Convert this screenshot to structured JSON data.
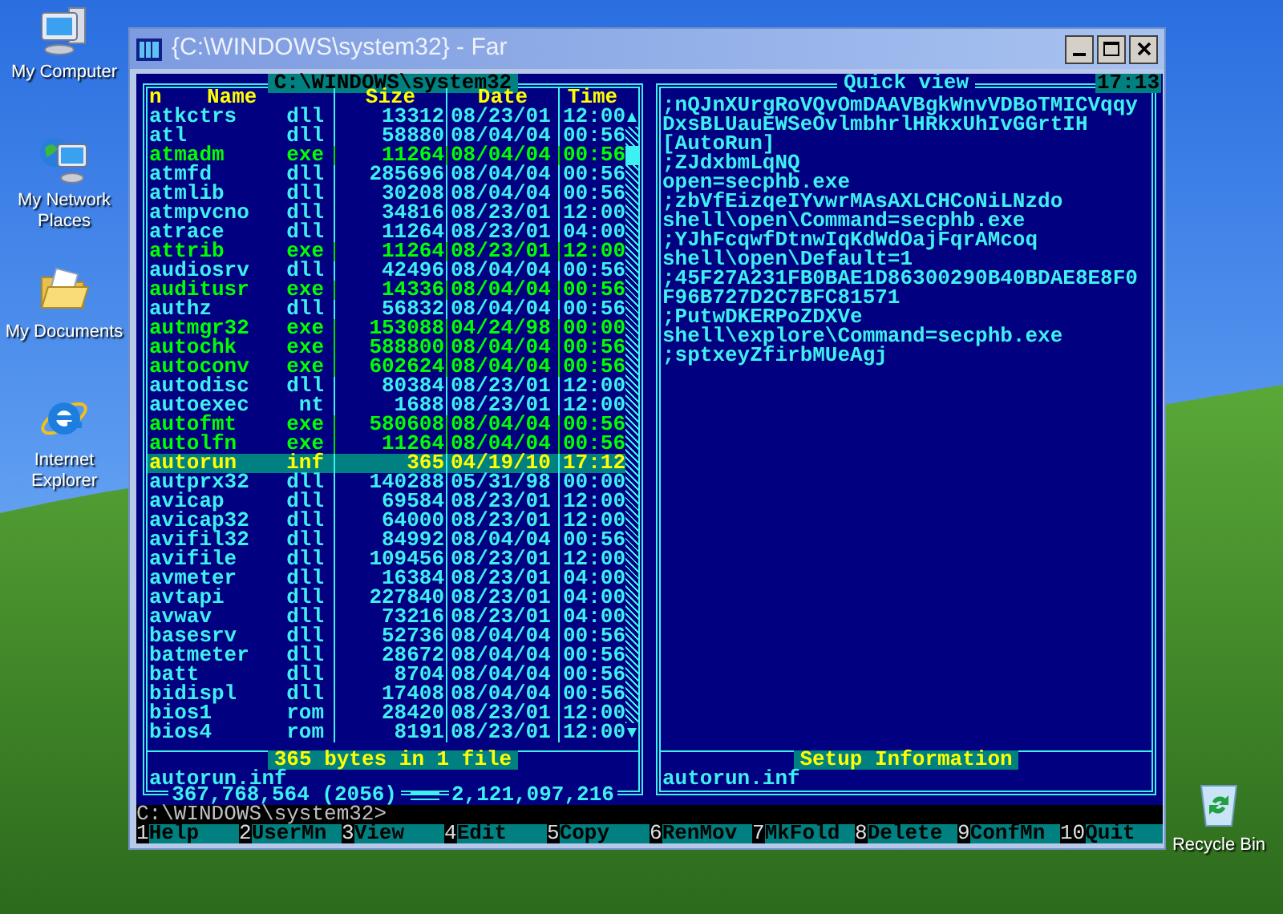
{
  "desktop_icons": [
    {
      "kind": "computer",
      "label": "My Computer"
    },
    {
      "kind": "network",
      "label": "My Network Places"
    },
    {
      "kind": "documents",
      "label": "My Documents"
    },
    {
      "kind": "browser",
      "label": "Internet Explorer"
    },
    {
      "kind": "recycle_bin",
      "label": "Recycle Bin"
    }
  ],
  "window": {
    "title": "{C:\\WINDOWS\\system32} - Far"
  },
  "left_panel": {
    "path": "C:\\WINDOWS\\system32",
    "columns": [
      "n",
      "Name",
      "Size",
      "Date",
      "Time"
    ],
    "files": [
      {
        "name": "atkctrs",
        "ext": "dll",
        "size": "13312",
        "date": "08/23/01",
        "time": "12:00",
        "executable": false,
        "selected": false
      },
      {
        "name": "atl",
        "ext": "dll",
        "size": "58880",
        "date": "08/04/04",
        "time": "00:56",
        "executable": false,
        "selected": false
      },
      {
        "name": "atmadm",
        "ext": "exe",
        "size": "11264",
        "date": "08/04/04",
        "time": "00:56",
        "executable": true,
        "selected": false
      },
      {
        "name": "atmfd",
        "ext": "dll",
        "size": "285696",
        "date": "08/04/04",
        "time": "00:56",
        "executable": false,
        "selected": false
      },
      {
        "name": "atmlib",
        "ext": "dll",
        "size": "30208",
        "date": "08/04/04",
        "time": "00:56",
        "executable": false,
        "selected": false
      },
      {
        "name": "atmpvcno",
        "ext": "dll",
        "size": "34816",
        "date": "08/23/01",
        "time": "12:00",
        "executable": false,
        "selected": false
      },
      {
        "name": "atrace",
        "ext": "dll",
        "size": "11264",
        "date": "08/23/01",
        "time": "04:00",
        "executable": false,
        "selected": false
      },
      {
        "name": "attrib",
        "ext": "exe",
        "size": "11264",
        "date": "08/23/01",
        "time": "12:00",
        "executable": true,
        "selected": false
      },
      {
        "name": "audiosrv",
        "ext": "dll",
        "size": "42496",
        "date": "08/04/04",
        "time": "00:56",
        "executable": false,
        "selected": false
      },
      {
        "name": "auditusr",
        "ext": "exe",
        "size": "14336",
        "date": "08/04/04",
        "time": "00:56",
        "executable": true,
        "selected": false
      },
      {
        "name": "authz",
        "ext": "dll",
        "size": "56832",
        "date": "08/04/04",
        "time": "00:56",
        "executable": false,
        "selected": false
      },
      {
        "name": "autmgr32",
        "ext": "exe",
        "size": "153088",
        "date": "04/24/98",
        "time": "00:00",
        "executable": true,
        "selected": false
      },
      {
        "name": "autochk",
        "ext": "exe",
        "size": "588800",
        "date": "08/04/04",
        "time": "00:56",
        "executable": true,
        "selected": false
      },
      {
        "name": "autoconv",
        "ext": "exe",
        "size": "602624",
        "date": "08/04/04",
        "time": "00:56",
        "executable": true,
        "selected": false
      },
      {
        "name": "autodisc",
        "ext": "dll",
        "size": "80384",
        "date": "08/23/01",
        "time": "12:00",
        "executable": false,
        "selected": false
      },
      {
        "name": "autoexec",
        "ext": "nt",
        "size": "1688",
        "date": "08/23/01",
        "time": "12:00",
        "executable": false,
        "selected": false
      },
      {
        "name": "autofmt",
        "ext": "exe",
        "size": "580608",
        "date": "08/04/04",
        "time": "00:56",
        "executable": true,
        "selected": false
      },
      {
        "name": "autolfn",
        "ext": "exe",
        "size": "11264",
        "date": "08/04/04",
        "time": "00:56",
        "executable": true,
        "selected": false
      },
      {
        "name": "autorun",
        "ext": "inf",
        "size": "365",
        "date": "04/19/10",
        "time": "17:12",
        "executable": false,
        "selected": true
      },
      {
        "name": "autprx32",
        "ext": "dll",
        "size": "140288",
        "date": "05/31/98",
        "time": "00:00",
        "executable": false,
        "selected": false
      },
      {
        "name": "avicap",
        "ext": "dll",
        "size": "69584",
        "date": "08/23/01",
        "time": "12:00",
        "executable": false,
        "selected": false
      },
      {
        "name": "avicap32",
        "ext": "dll",
        "size": "64000",
        "date": "08/23/01",
        "time": "12:00",
        "executable": false,
        "selected": false
      },
      {
        "name": "avifil32",
        "ext": "dll",
        "size": "84992",
        "date": "08/04/04",
        "time": "00:56",
        "executable": false,
        "selected": false
      },
      {
        "name": "avifile",
        "ext": "dll",
        "size": "109456",
        "date": "08/23/01",
        "time": "12:00",
        "executable": false,
        "selected": false
      },
      {
        "name": "avmeter",
        "ext": "dll",
        "size": "16384",
        "date": "08/23/01",
        "time": "04:00",
        "executable": false,
        "selected": false
      },
      {
        "name": "avtapi",
        "ext": "dll",
        "size": "227840",
        "date": "08/23/01",
        "time": "04:00",
        "executable": false,
        "selected": false
      },
      {
        "name": "avwav",
        "ext": "dll",
        "size": "73216",
        "date": "08/23/01",
        "time": "04:00",
        "executable": false,
        "selected": false
      },
      {
        "name": "basesrv",
        "ext": "dll",
        "size": "52736",
        "date": "08/04/04",
        "time": "00:56",
        "executable": false,
        "selected": false
      },
      {
        "name": "batmeter",
        "ext": "dll",
        "size": "28672",
        "date": "08/04/04",
        "time": "00:56",
        "executable": false,
        "selected": false
      },
      {
        "name": "batt",
        "ext": "dll",
        "size": "8704",
        "date": "08/04/04",
        "time": "00:56",
        "executable": false,
        "selected": false
      },
      {
        "name": "bidispl",
        "ext": "dll",
        "size": "17408",
        "date": "08/04/04",
        "time": "00:56",
        "executable": false,
        "selected": false
      },
      {
        "name": "bios1",
        "ext": "rom",
        "size": "28420",
        "date": "08/23/01",
        "time": "12:00",
        "executable": false,
        "selected": false
      },
      {
        "name": "bios4",
        "ext": "rom",
        "size": "8191",
        "date": "08/23/01",
        "time": "12:00",
        "executable": false,
        "selected": false
      }
    ],
    "selection_info": "365 bytes in 1 file",
    "current_file": "autorun.inf",
    "total_size": "367,768,564 (2056)",
    "free_space": "2,121,097,216"
  },
  "right_panel": {
    "title": "Quick view",
    "clock": "17:13",
    "lines": [
      ";nQJnXUrgRoVQvOmDAAVBgkWnvVDBoTMICVqqy",
      "DxsBLUauEWSeOvlmbhrlHRkxUhIvGGrtIH",
      "[AutoRun]",
      ";ZJdxbmLqNQ",
      "open=secphb.exe",
      ";zbVfEizqeIYvwrMAsAXLCHCoNiLNzdo",
      "shell\\open\\Command=secphb.exe",
      ";YJhFcqwfDtnwIqKdWdOajFqrAMcoq",
      "shell\\open\\Default=1",
      ";45F27A231FB0BAE1D86300290B40BDAE8E8F0",
      "F96B727D2C7BFC81571",
      ";PutwDKERPoZDXVe",
      "shell\\explore\\Command=secphb.exe",
      ";sptxeyZfirbMUeAgj"
    ],
    "file_type": "Setup Information",
    "file_name": "autorun.inf"
  },
  "command_line": "C:\\WINDOWS\\system32>",
  "keybar": [
    {
      "key": "1",
      "label": "Help"
    },
    {
      "key": "2",
      "label": "UserMn"
    },
    {
      "key": "3",
      "label": "View"
    },
    {
      "key": "4",
      "label": "Edit"
    },
    {
      "key": "5",
      "label": "Copy"
    },
    {
      "key": "6",
      "label": "RenMov"
    },
    {
      "key": "7",
      "label": "MkFold"
    },
    {
      "key": "8",
      "label": "Delete"
    },
    {
      "key": "9",
      "label": "ConfMn"
    },
    {
      "key": "10",
      "label": "Quit"
    }
  ]
}
